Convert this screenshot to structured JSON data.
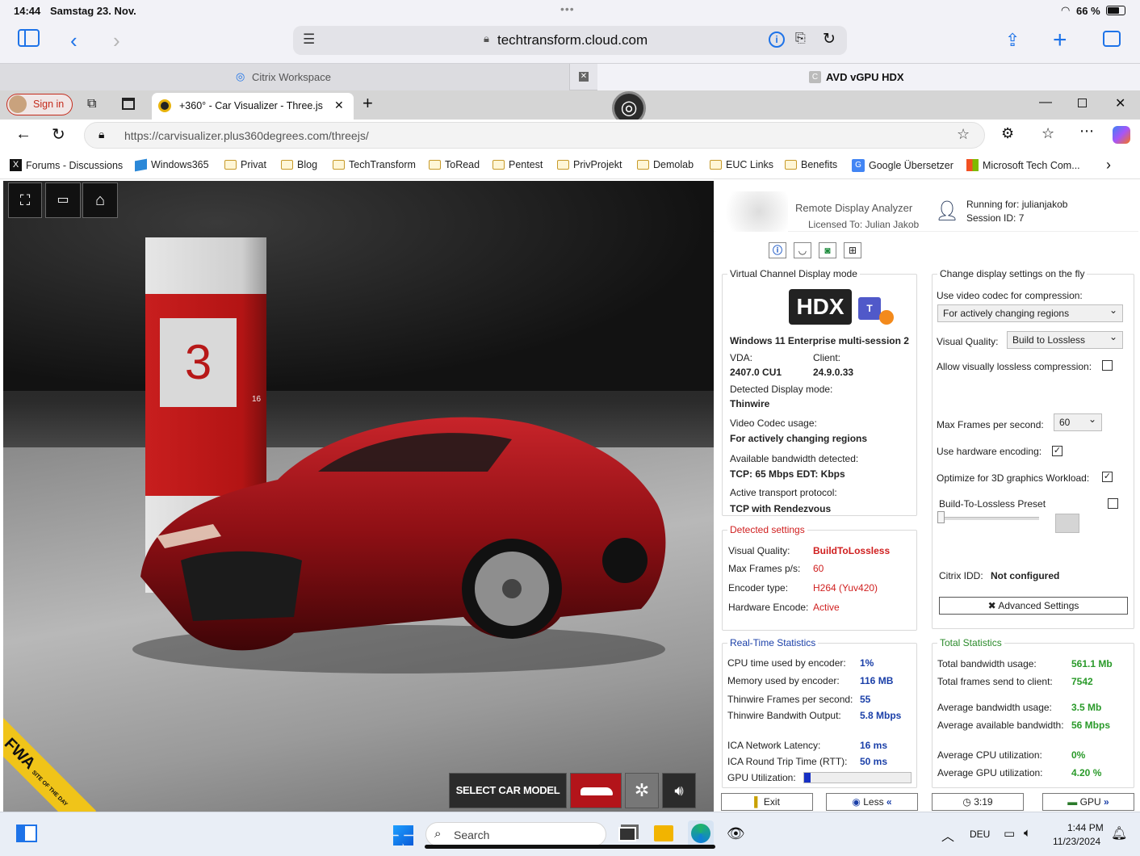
{
  "status": {
    "time": "14:44",
    "date": "Samstag 23. Nov.",
    "battery": "66 %",
    "dots": "•••"
  },
  "safari": {
    "url": "techtransform.cloud.com",
    "tab1": "Citrix Workspace",
    "tab2": "AVD vGPU HDX",
    "tab2_badge": "C"
  },
  "edge": {
    "signin": "Sign in",
    "tab_title": "+360° - Car Visualizer - Three.js",
    "url": "https://carvisualizer.plus360degrees.com/threejs/"
  },
  "favorites": [
    "Forums - Discussions",
    "Windows365",
    "Privat",
    "Blog",
    "TechTransform",
    "ToRead",
    "Pentest",
    "PrivProjekt",
    "Demolab",
    "EUC Links",
    "Benefits",
    "Google Übersetzer",
    "Microsoft Tech Com..."
  ],
  "scene": {
    "pillar_number": "3",
    "pillar_small": "16",
    "select_label": "SELECT CAR MODEL",
    "badge": "FWA",
    "badge_sub": "SITE OF THE DAY"
  },
  "rda": {
    "app_name": "Remote Display Analyzer",
    "licensed": "Licensed To: Julian Jakob",
    "running_for": "Running for: julianjakob",
    "session_id": "Session ID: 7",
    "vc": {
      "title": "Virtual Channel Display mode",
      "hdx": "HDX",
      "os": "Windows 11 Enterprise multi-session 2",
      "vda_label": "VDA:",
      "vda": "2407.0 CU1",
      "client_label": "Client:",
      "client": "24.9.0.33",
      "ddm_label": "Detected Display mode:",
      "ddm": "Thinwire",
      "codec_label": "Video Codec usage:",
      "codec": "For actively changing regions",
      "bw_label": "Available bandwidth detected:",
      "bw": "TCP: 65 Mbps EDT: Kbps",
      "proto_label": "Active transport protocol:",
      "proto": "TCP with Rendezvous"
    },
    "change": {
      "title": "Change display settings on the fly",
      "codec_label": "Use video codec for compression:",
      "codec": "For actively changing regions",
      "vq_label": "Visual Quality:",
      "vq": "Build to Lossless",
      "lossless_label": "Allow visually lossless compression:",
      "fps_label": "Max Frames per second:",
      "fps": "60",
      "hw_label": "Use hardware encoding:",
      "opt3d_label": "Optimize for 3D graphics Workload:",
      "btl_label": "Build-To-Lossless Preset",
      "idd_label": "Citrix IDD:",
      "idd": "Not configured",
      "adv": "Advanced Settings",
      "check": "✓"
    },
    "detected": {
      "title": "Detected settings",
      "vq_label": "Visual Quality:",
      "vq": "BuildToLossless",
      "fps_label": "Max Frames p/s:",
      "fps": "60",
      "enc_label": "Encoder type:",
      "enc": "H264 (Yuv420)",
      "hw_label": "Hardware Encode:",
      "hw": "Active"
    },
    "rt": {
      "title": "Real-Time Statistics",
      "cpu_label": "CPU time used by encoder:",
      "cpu": "1%",
      "mem_label": "Memory used by encoder:",
      "mem": "116 MB",
      "tw_fps_label": "Thinwire Frames per second:",
      "tw_fps": "55",
      "tw_bw_label": "Thinwire Bandwith Output:",
      "tw_bw": "5.8 Mbps",
      "lat_label": "ICA Network Latency:",
      "lat": "16 ms",
      "rtt_label": "ICA Round Trip Time (RTT):",
      "rtt": "50 ms",
      "gpu_label": "GPU Utilization:",
      "gpu_fraction": 0.06
    },
    "total": {
      "title": "Total Statistics",
      "bw_label": "Total bandwidth usage:",
      "bw": "561.1 Mb",
      "frames_label": "Total frames send to client:",
      "frames": "7542",
      "avgbw_label": "Average bandwidth usage:",
      "avgbw": "3.5 Mb",
      "avail_label": "Average available bandwidth:",
      "avail": "56 Mbps",
      "cpu_label": "Average CPU utilization:",
      "cpu": "0%",
      "gpu_label": "Average GPU utilization:",
      "gpu": "4.20 %"
    },
    "buttons": {
      "exit": "Exit",
      "less": "Less",
      "time": "3:19",
      "gpu": "GPU"
    }
  },
  "taskbar": {
    "search": "Search",
    "lang": "DEU",
    "time": "1:44 PM",
    "date": "11/23/2024"
  }
}
